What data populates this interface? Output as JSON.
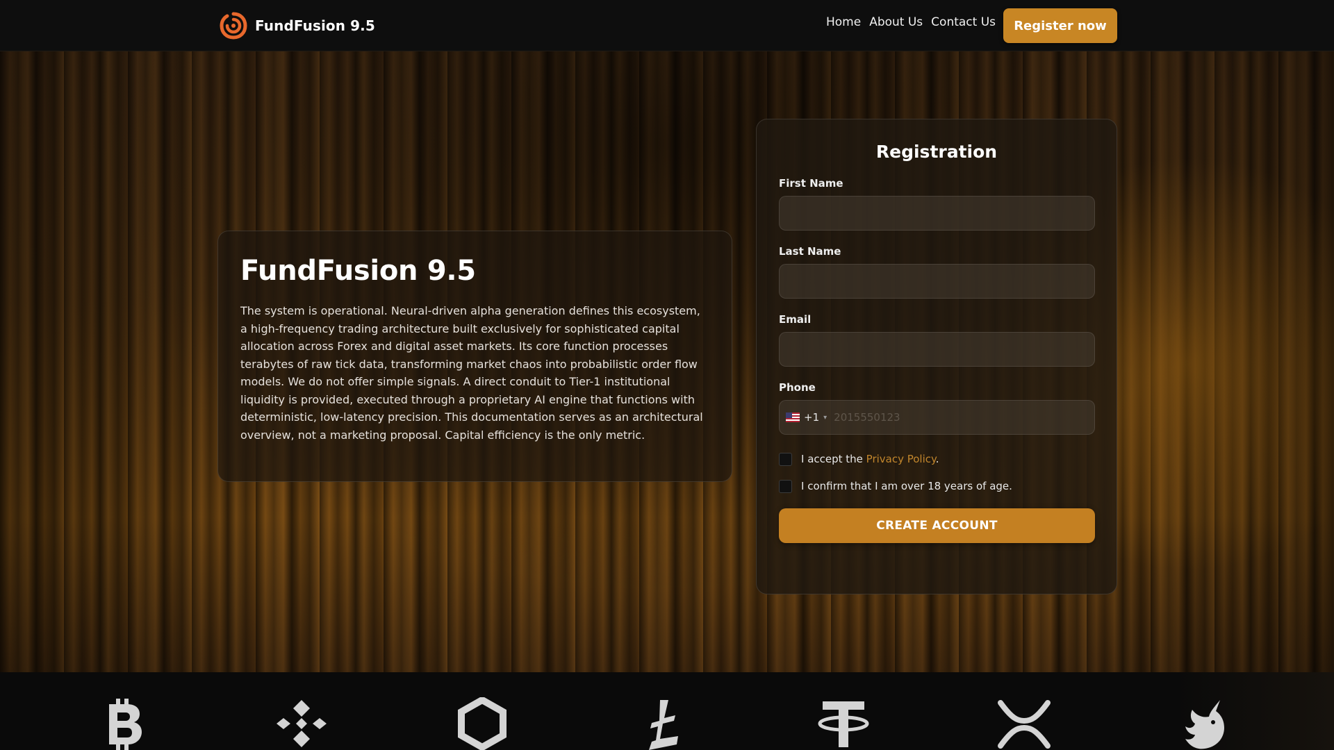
{
  "brand": {
    "name": "FundFusion 9.5",
    "logo_icon": "spiral-logo-icon",
    "accent_color": "#e8682c"
  },
  "nav": {
    "links": [
      "Home",
      "About Us",
      "Contact Us"
    ],
    "register_label": "Register now"
  },
  "hero": {
    "title": "FundFusion 9.5",
    "description": "The system is operational. Neural-driven alpha generation defines this ecosystem, a high-frequency trading architecture built exclusively for sophisticated capital allocation across Forex and digital asset markets. Its core function processes terabytes of raw tick data, transforming market chaos into probabilistic order flow models. We do not offer simple signals. A direct conduit to Tier-1 institutional liquidity is provided, executed through a proprietary AI engine that functions with deterministic, low-latency precision. This documentation serves as an architectural overview, not a marketing proposal. Capital efficiency is the only metric."
  },
  "registration": {
    "title": "Registration",
    "first_name_label": "First Name",
    "first_name_value": "",
    "last_name_label": "Last Name",
    "last_name_value": "",
    "email_label": "Email",
    "email_value": "",
    "phone_label": "Phone",
    "phone_country_code": "+1",
    "phone_flag_icon": "us-flag-icon",
    "phone_placeholder": "2015550123",
    "privacy_prefix": "I accept the ",
    "privacy_link": "Privacy Policy",
    "privacy_suffix": ".",
    "privacy_checked": false,
    "age_text": "I confirm that I am over 18 years of age.",
    "age_checked": false,
    "submit_label": "CREATE ACCOUNT",
    "button_color": "#c48022"
  },
  "crypto_icons": [
    "bitcoin-icon",
    "binance-icon",
    "chainlink-icon",
    "tron-icon",
    "tether-icon",
    "xrp-icon",
    "uniswap-icon"
  ]
}
